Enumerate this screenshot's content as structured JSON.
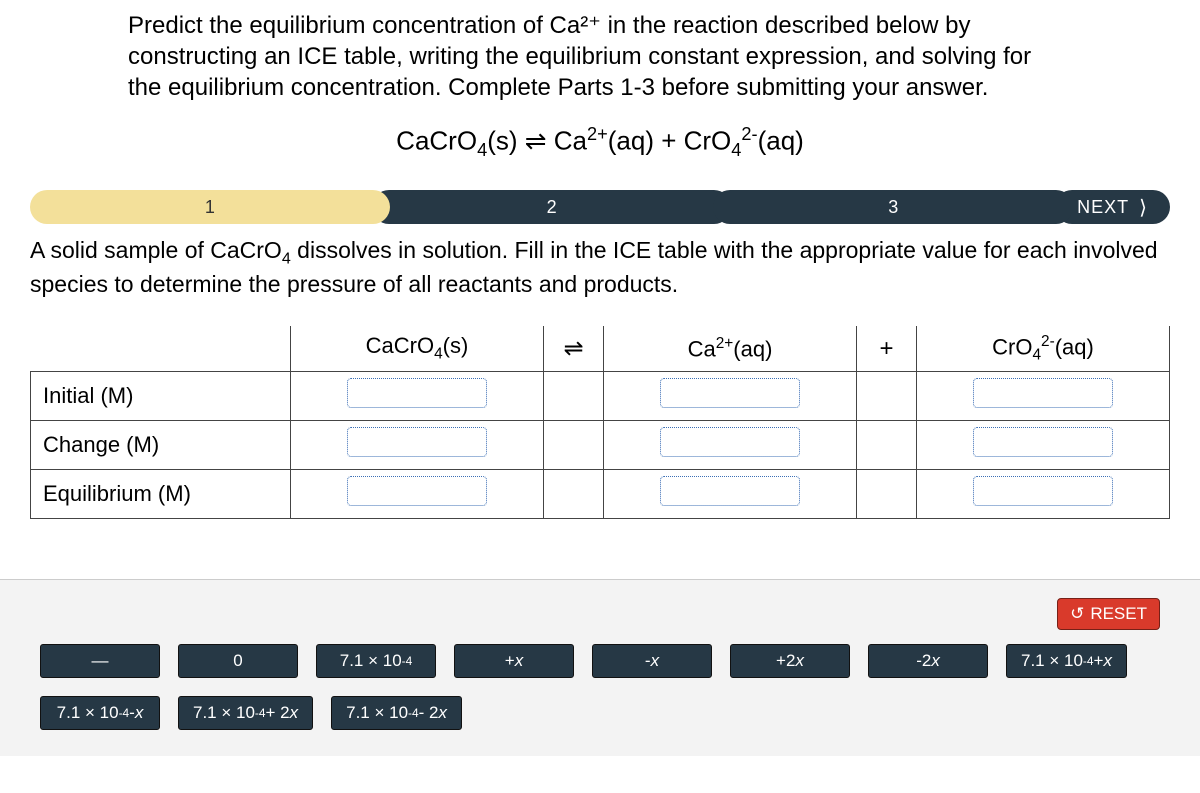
{
  "prompt": "Predict the equilibrium concentration of Ca²⁺ in the reaction described below by constructing an ICE table, writing the equilibrium constant expression, and solving for the equilibrium concentration. Complete Parts 1-3 before submitting your answer.",
  "equation_html": "CaCrO<sub>4</sub>(s) ⇌ Ca<sup>2+</sup>(aq) + CrO<sub>4</sub><sup>2-</sup>(aq)",
  "steps": {
    "labels": [
      "1",
      "2",
      "3"
    ],
    "next": "NEXT"
  },
  "subprompt_html": "A solid sample of CaCrO<sub>4</sub> dissolves in solution. Fill in the ICE table with the appropriate value for each involved species to determine the pressure of all reactants and products.",
  "table": {
    "cols": {
      "c1_html": "CaCrO<sub>4</sub>(s)",
      "op1": "⇌",
      "c2_html": "Ca<sup>2+</sup>(aq)",
      "op2": "+",
      "c3_html": "CrO<sub>4</sub><sup>2-</sup>(aq)"
    },
    "rows": [
      "Initial (M)",
      "Change (M)",
      "Equilibrium (M)"
    ]
  },
  "reset": "RESET",
  "tiles": [
    {
      "html": "—"
    },
    {
      "html": "0"
    },
    {
      "html": "7.1 × 10<sup>-4</sup>"
    },
    {
      "html": "+<span class='xi'>x</span>"
    },
    {
      "html": "-<span class='xi'>x</span>"
    },
    {
      "html": "+2<span class='xi'>x</span>"
    },
    {
      "html": "-2<span class='xi'>x</span>"
    },
    {
      "html": "7.1 × 10<sup>-4</sup> + <span class='xi'>x</span>"
    },
    {
      "html": "7.1 × 10<sup>-4</sup> - <span class='xi'>x</span>"
    },
    {
      "html": "7.1 × 10<sup>-4</sup> + 2<span class='xi'>x</span>"
    },
    {
      "html": "7.1 × 10<sup>-4</sup> - 2<span class='xi'>x</span>"
    }
  ]
}
